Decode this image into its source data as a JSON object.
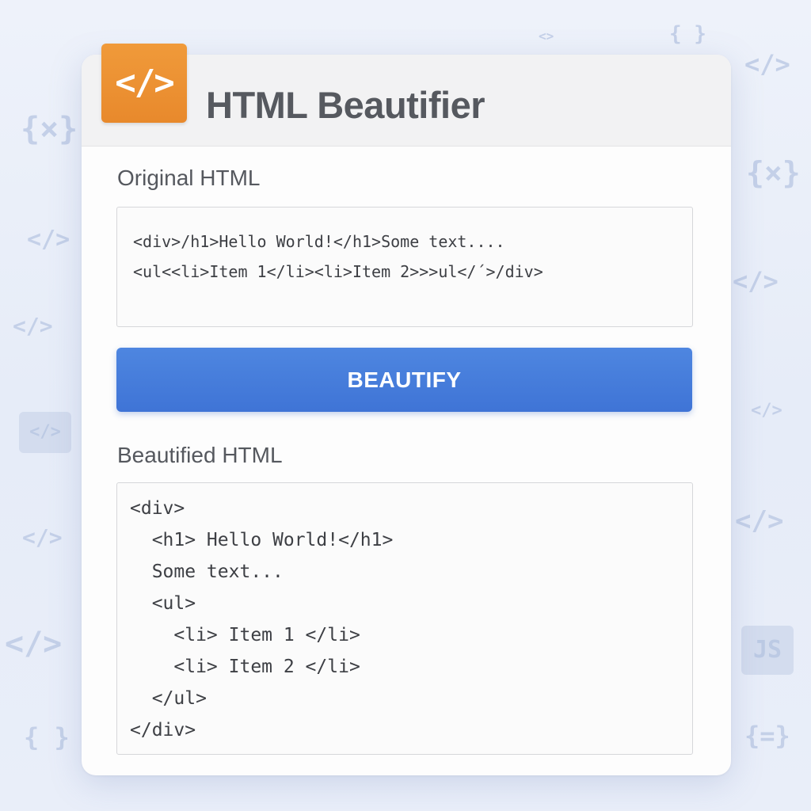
{
  "app": {
    "title": "HTML Beautifier",
    "logo_icon": "code-brackets-icon",
    "logo_glyph": "</>",
    "logo_color": "#e8892c"
  },
  "original": {
    "label": "Original HTML",
    "lines": [
      "<div>/h1>Hello World!</h1>Some text....",
      "<ul<<li>Item 1</li><li>Item 2>>>ul</´>/div>"
    ]
  },
  "button": {
    "label": "BEAUTIFY",
    "color": "#4a80de"
  },
  "beautified": {
    "label": "Beautified HTML",
    "lines": [
      "<div>",
      "  <h1> Hello World!</h1>",
      "  Some text...",
      "  <ul>",
      "    <li> Item 1 </li>",
      "    <li> Item 2 </li>",
      "  </ul>",
      "</div>"
    ]
  },
  "background_icons": [
    {
      "name": "curly-x-icon",
      "glyph": "{×}"
    },
    {
      "name": "code-brackets-icon",
      "glyph": "</>"
    },
    {
      "name": "curly-braces-icon",
      "glyph": "{ }"
    },
    {
      "name": "angle-brackets-icon",
      "glyph": "<>"
    },
    {
      "name": "js-file-icon",
      "glyph": "JS"
    },
    {
      "name": "curly-equals-icon",
      "glyph": "{=}"
    }
  ]
}
